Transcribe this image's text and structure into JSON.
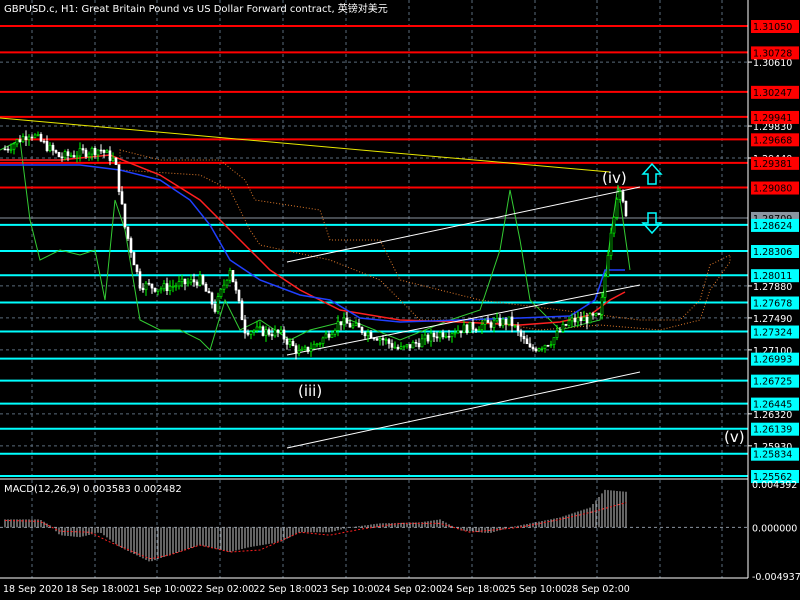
{
  "title": "GBPUSD.c, H1:  Great Britain Pound vs US Dollar Forward contract, 英镑对美元",
  "colors": {
    "bg": "#000000",
    "bull": "#00ff00",
    "bear": "#ffffff",
    "level_red": "#ff0000",
    "level_cyan": "#00ffff",
    "grid": "#5a6b7b"
  },
  "price_axis": {
    "max": 1.3105,
    "min": 1.25562,
    "ticks": [
      "1.30610",
      "1.29830",
      "1.29440",
      "1.27880",
      "1.27490",
      "1.27100",
      "1.26320",
      "1.25930"
    ],
    "red_levels": [
      "1.31050",
      "1.30728",
      "1.30247",
      "1.29941",
      "1.29668",
      "1.29381",
      "1.29080"
    ],
    "cyan_levels": [
      "1.28624",
      "1.28306",
      "1.28011",
      "1.27678",
      "1.27324",
      "1.26993",
      "1.26725",
      "1.26445",
      "1.26139",
      "1.25834",
      "1.25562"
    ],
    "bid_label": "1.28709"
  },
  "wave_labels": {
    "iii": "(iii)",
    "iv": "(iv)",
    "v": "(v)"
  },
  "price_path": [
    [
      5,
      1.2955
    ],
    [
      30,
      1.2975
    ],
    [
      60,
      1.2945
    ],
    [
      100,
      1.2955
    ],
    [
      115,
      1.294
    ],
    [
      125,
      1.286
    ],
    [
      140,
      1.279
    ],
    [
      160,
      1.2785
    ],
    [
      200,
      1.2795
    ],
    [
      215,
      1.276
    ],
    [
      230,
      1.281
    ],
    [
      245,
      1.2735
    ],
    [
      280,
      1.273
    ],
    [
      300,
      1.2705
    ],
    [
      320,
      1.272
    ],
    [
      340,
      1.2745
    ],
    [
      380,
      1.2725
    ],
    [
      400,
      1.271
    ],
    [
      440,
      1.273
    ],
    [
      480,
      1.274
    ],
    [
      510,
      1.2745
    ],
    [
      530,
      1.271
    ],
    [
      550,
      1.272
    ],
    [
      570,
      1.2745
    ],
    [
      600,
      1.275
    ],
    [
      610,
      1.285
    ],
    [
      618,
      1.2905
    ],
    [
      626,
      1.2878
    ]
  ],
  "macd": {
    "label": "MACD(12,26,9) 0.003583 0.002482",
    "max_label": "0.004392",
    "zero_label": "0.000000",
    "min_label": "-0.004937",
    "max": 0.004392,
    "min": -0.004937,
    "hist": [
      [
        5,
        0.0008
      ],
      [
        40,
        0.0008
      ],
      [
        50,
        0.0002
      ],
      [
        60,
        -0.0008
      ],
      [
        80,
        -0.001
      ],
      [
        100,
        -0.0005
      ],
      [
        120,
        -0.002
      ],
      [
        150,
        -0.0035
      ],
      [
        170,
        -0.0028
      ],
      [
        200,
        -0.0018
      ],
      [
        230,
        -0.0025
      ],
      [
        250,
        -0.002
      ],
      [
        280,
        -0.0015
      ],
      [
        300,
        -0.0005
      ],
      [
        330,
        -0.0005
      ],
      [
        350,
        0.0
      ],
      [
        380,
        0.0004
      ],
      [
        420,
        0.0005
      ],
      [
        440,
        0.0008
      ],
      [
        460,
        -0.0003
      ],
      [
        490,
        -0.0006
      ],
      [
        510,
        0.0
      ],
      [
        560,
        0.001
      ],
      [
        590,
        0.002
      ],
      [
        605,
        0.0038
      ],
      [
        626,
        0.0036
      ]
    ],
    "signal": [
      [
        5,
        0.0007
      ],
      [
        40,
        0.0006
      ],
      [
        60,
        -0.0004
      ],
      [
        90,
        -0.0005
      ],
      [
        110,
        -0.0015
      ],
      [
        150,
        -0.0032
      ],
      [
        170,
        -0.0028
      ],
      [
        200,
        -0.0018
      ],
      [
        230,
        -0.0025
      ],
      [
        260,
        -0.0023
      ],
      [
        300,
        -0.0005
      ],
      [
        330,
        -0.0008
      ],
      [
        360,
        -0.0002
      ],
      [
        400,
        0.0004
      ],
      [
        440,
        0.0004
      ],
      [
        470,
        -0.0005
      ],
      [
        520,
        0.0
      ],
      [
        560,
        0.0008
      ],
      [
        590,
        0.0015
      ],
      [
        626,
        0.0025
      ]
    ]
  },
  "time_axis": [
    "18 Sep 2020",
    "18 Sep 18:00",
    "21 Sep 10:00",
    "22 Sep 02:00",
    "22 Sep 18:00",
    "23 Sep 10:00",
    "24 Sep 02:00",
    "24 Sep 18:00",
    "25 Sep 10:00",
    "28 Sep 02:00"
  ]
}
